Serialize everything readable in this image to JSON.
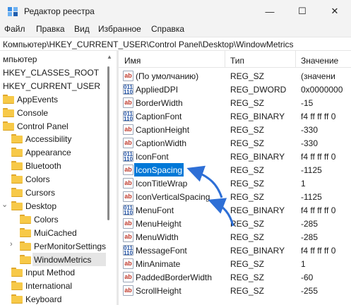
{
  "window": {
    "title": "Редактор реестра",
    "minimize_glyph": "—",
    "maximize_glyph": "☐",
    "close_glyph": "✕"
  },
  "menu": [
    "Файл",
    "Правка",
    "Вид",
    "Избранное",
    "Справка"
  ],
  "address": "Компьютер\\HKEY_CURRENT_USER\\Control Panel\\Desktop\\WindowMetrics",
  "tree": {
    "items": [
      {
        "label": "мпьютер",
        "chevron": "",
        "folder": false
      },
      {
        "label": "HKEY_CLASSES_ROOT",
        "chevron": "",
        "folder": false
      },
      {
        "label": "HKEY_CURRENT_USER",
        "chevron": "",
        "folder": false
      },
      {
        "label": "AppEvents",
        "chevron": "",
        "folder": true
      },
      {
        "label": "Console",
        "chevron": "",
        "folder": true
      },
      {
        "label": "Control Panel",
        "chevron": "",
        "folder": true
      },
      {
        "label": "Accessibility",
        "chevron": "",
        "folder": true
      },
      {
        "label": "Appearance",
        "chevron": "",
        "folder": true
      },
      {
        "label": "Bluetooth",
        "chevron": "",
        "folder": true
      },
      {
        "label": "Colors",
        "chevron": "",
        "folder": true
      },
      {
        "label": "Cursors",
        "chevron": "",
        "folder": true
      },
      {
        "label": "Desktop",
        "chevron": "⌄",
        "folder": true
      },
      {
        "label": "Colors",
        "chevron": "",
        "folder": true
      },
      {
        "label": "MuiCached",
        "chevron": "",
        "folder": true
      },
      {
        "label": "PerMonitorSettings",
        "chevron": "›",
        "folder": true
      },
      {
        "label": "WindowMetrics",
        "chevron": "",
        "folder": true
      },
      {
        "label": "Input Method",
        "chevron": "",
        "folder": true
      },
      {
        "label": "International",
        "chevron": "",
        "folder": true
      },
      {
        "label": "Keyboard",
        "chevron": "",
        "folder": true
      }
    ]
  },
  "list": {
    "columns": [
      "Имя",
      "Тип",
      "Значение"
    ],
    "rows": [
      {
        "kind": "str",
        "name": "(По умолчанию)",
        "type": "REG_SZ",
        "value": "(значени"
      },
      {
        "kind": "bin",
        "name": "AppliedDPI",
        "type": "REG_DWORD",
        "value": "0x0000000"
      },
      {
        "kind": "str",
        "name": "BorderWidth",
        "type": "REG_SZ",
        "value": "-15"
      },
      {
        "kind": "bin",
        "name": "CaptionFont",
        "type": "REG_BINARY",
        "value": "f4 ff ff ff 0"
      },
      {
        "kind": "str",
        "name": "CaptionHeight",
        "type": "REG_SZ",
        "value": "-330"
      },
      {
        "kind": "str",
        "name": "CaptionWidth",
        "type": "REG_SZ",
        "value": "-330"
      },
      {
        "kind": "bin",
        "name": "IconFont",
        "type": "REG_BINARY",
        "value": "f4 ff ff ff 0"
      },
      {
        "kind": "str",
        "name": "IconSpacing",
        "type": "REG_SZ",
        "value": "-1125"
      },
      {
        "kind": "str",
        "name": "IconTitleWrap",
        "type": "REG_SZ",
        "value": "1"
      },
      {
        "kind": "str",
        "name": "IconVerticalSpacing",
        "type": "REG_SZ",
        "value": "-1125"
      },
      {
        "kind": "bin",
        "name": "MenuFont",
        "type": "REG_BINARY",
        "value": "f4 ff ff ff 0"
      },
      {
        "kind": "str",
        "name": "MenuHeight",
        "type": "REG_SZ",
        "value": "-285"
      },
      {
        "kind": "str",
        "name": "MenuWidth",
        "type": "REG_SZ",
        "value": "-285"
      },
      {
        "kind": "bin",
        "name": "MessageFont",
        "type": "REG_BINARY",
        "value": "f4 ff ff ff 0"
      },
      {
        "kind": "str",
        "name": "MinAnimate",
        "type": "REG_SZ",
        "value": "1"
      },
      {
        "kind": "str",
        "name": "PaddedBorderWidth",
        "type": "REG_SZ",
        "value": "-60"
      },
      {
        "kind": "str",
        "name": "ScrollHeight",
        "type": "REG_SZ",
        "value": "-255"
      }
    ]
  },
  "icons": {
    "string_value": "ab",
    "binary_value": "011\n110"
  },
  "colors": {
    "accent": "#0078d7",
    "annotation_arrow": "#2e6fd6"
  }
}
